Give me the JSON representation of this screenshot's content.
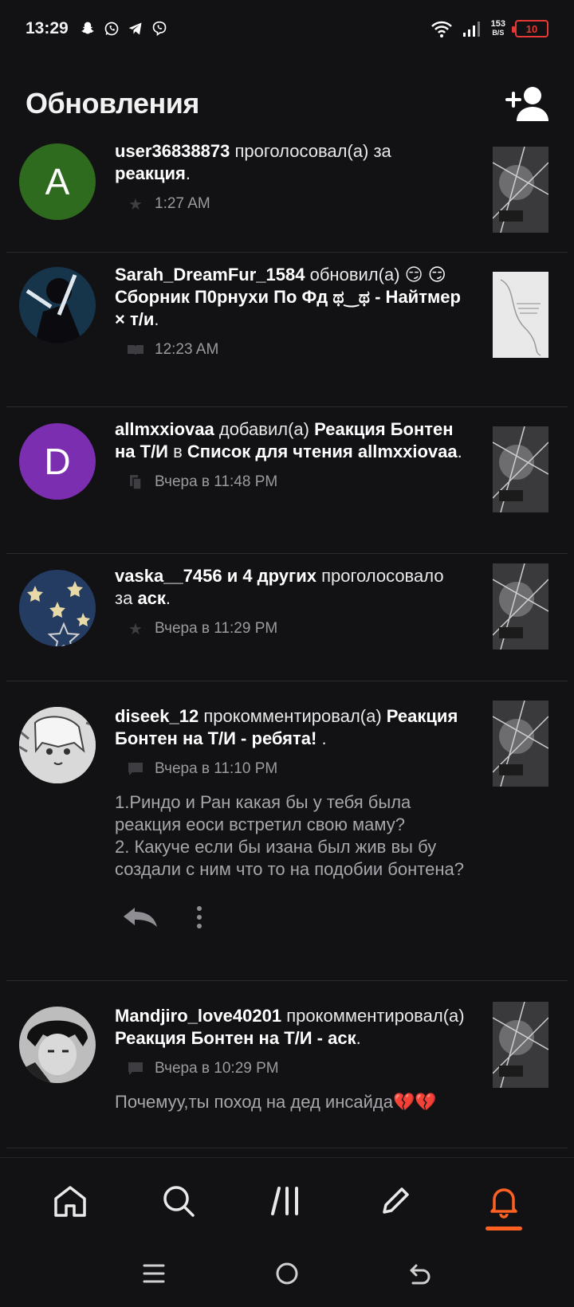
{
  "status_bar": {
    "time": "13:29",
    "net_speed": "153",
    "net_unit": "B/S",
    "battery": "10",
    "notification_icons": [
      "snapchat-icon",
      "whatsapp-icon",
      "telegram-icon",
      "viber-icon"
    ]
  },
  "header": {
    "title": "Обновления",
    "add_user_icon": "add-user-icon"
  },
  "feed": [
    {
      "avatar_letter": "A",
      "avatar_color": "#2f6b1f",
      "parts": [
        {
          "text": "user36838873",
          "bold": true
        },
        {
          "text": " проголосовал(а) за ",
          "bold": false
        },
        {
          "text": "реакция",
          "bold": true
        },
        {
          "text": ".",
          "bold": false
        }
      ],
      "meta_icon": "star-icon",
      "time": "1:27 AM"
    },
    {
      "avatar_letter": "",
      "avatar_color": "#1d2a3a",
      "parts": [
        {
          "text": "Sarah_DreamFur_1584",
          "bold": true
        },
        {
          "text": " обновил(а) 😏 ",
          "bold": false
        },
        {
          "text": "😏 Сборник П0рнухи По Фд ಥ‿ಥ - Найтмер × т/и",
          "bold": true
        },
        {
          "text": ".",
          "bold": false
        }
      ],
      "meta_icon": "book-icon",
      "time": "12:23 AM"
    },
    {
      "avatar_letter": "D",
      "avatar_color": "#7b2fb0",
      "parts": [
        {
          "text": "allmxxiovaa",
          "bold": true
        },
        {
          "text": " добавил(а) ",
          "bold": false
        },
        {
          "text": "Реакция Бонтен на Т/И",
          "bold": true
        },
        {
          "text": " в ",
          "bold": false
        },
        {
          "text": "Список для чтения allmxxiovaa",
          "bold": true
        },
        {
          "text": ".",
          "bold": false
        }
      ],
      "meta_icon": "reading-list-icon",
      "time": "Вчера в 11:48 PM"
    },
    {
      "avatar_letter": "",
      "avatar_color": "#1f3a66",
      "parts": [
        {
          "text": "vaska__7456 и 4 других",
          "bold": true
        },
        {
          "text": " проголосовало за ",
          "bold": false
        },
        {
          "text": "аск",
          "bold": true
        },
        {
          "text": ".",
          "bold": false
        }
      ],
      "meta_icon": "star-icon",
      "time": "Вчера в 11:29 PM"
    },
    {
      "avatar_letter": "",
      "avatar_color": "#d8d8d8",
      "parts": [
        {
          "text": "diseek_12",
          "bold": true
        },
        {
          "text": " прокомментировал(а) ",
          "bold": false
        },
        {
          "text": "Реакция Бонтен на Т/И - ребята!",
          "bold": true
        },
        {
          "text": " .",
          "bold": false
        }
      ],
      "meta_icon": "comment-icon",
      "time": "Вчера в 11:10 PM",
      "comment": "1.Риндо и Ран какая бы у тебя была реакция еоси встретил свою маму?\n2. Какуче если бы изана был жив вы бу создали с ним что то на подобии бонтена?"
    },
    {
      "avatar_letter": "",
      "avatar_color": "#2b2b2b",
      "parts": [
        {
          "text": "Mandjiro_love40201",
          "bold": true
        },
        {
          "text": " прокомментировал(а) ",
          "bold": false
        },
        {
          "text": "Реакция Бонтен на Т/И - аск",
          "bold": true
        },
        {
          "text": ".",
          "bold": false
        }
      ],
      "meta_icon": "comment-icon",
      "time": "Вчера в 10:29 PM",
      "comment": "Почемуу,ты поход на дед инсайда💔💔"
    }
  ],
  "bottom_nav": [
    "home-icon",
    "search-icon",
    "library-icon",
    "write-icon",
    "notifications-icon"
  ],
  "accent_color": "#ff6122"
}
